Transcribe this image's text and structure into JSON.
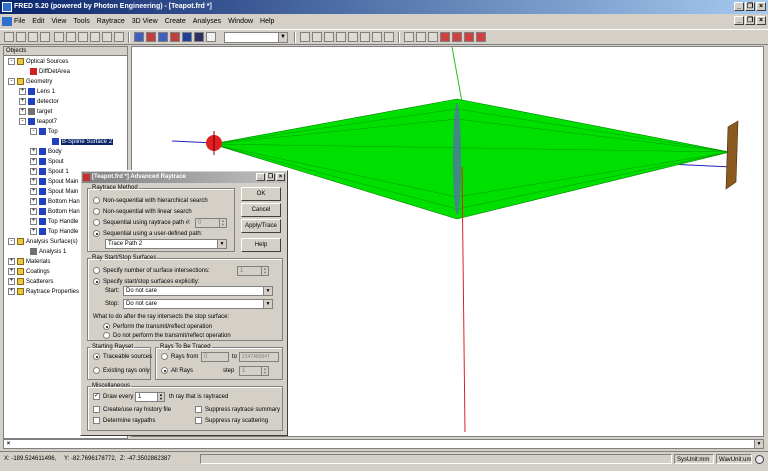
{
  "window": {
    "title": "FRED 5.20 (powered by Photon Engineering) - [Teapot.frd *]",
    "min": "_",
    "restore": "❐",
    "close": "×"
  },
  "menu": [
    "File",
    "Edit",
    "View",
    "Tools",
    "Raytrace",
    "3D View",
    "Create",
    "Analyses",
    "Window",
    "Help"
  ],
  "tree": {
    "header": "Objects",
    "nodes": [
      {
        "label": "Optical Sources",
        "exp": "-",
        "icon": "folder"
      },
      {
        "label": "DiffDetArea",
        "exp": "",
        "icon": "red"
      },
      {
        "label": "Geometry",
        "exp": "-",
        "icon": "folder"
      },
      {
        "label": "Lens 1",
        "exp": "+",
        "icon": "blue"
      },
      {
        "label": "detector",
        "exp": "+",
        "icon": "blue"
      },
      {
        "label": "target",
        "exp": "+",
        "icon": "grey"
      },
      {
        "label": "teapot7",
        "exp": "-",
        "icon": "blue"
      },
      {
        "label": "Top",
        "exp": "-",
        "icon": "blue"
      },
      {
        "label": "B-Spline Surface 2",
        "exp": "",
        "icon": "blue"
      },
      {
        "label": "Body",
        "exp": "+",
        "icon": "blue"
      },
      {
        "label": "Spout",
        "exp": "+",
        "icon": "blue"
      },
      {
        "label": "Spout 1",
        "exp": "+",
        "icon": "blue"
      },
      {
        "label": "Spout Main",
        "exp": "+",
        "icon": "blue"
      },
      {
        "label": "Spout Main",
        "exp": "+",
        "icon": "blue"
      },
      {
        "label": "Bottom Han",
        "exp": "+",
        "icon": "blue"
      },
      {
        "label": "Bottom Han",
        "exp": "+",
        "icon": "blue"
      },
      {
        "label": "Top Handle",
        "exp": "+",
        "icon": "blue"
      },
      {
        "label": "Top Handle",
        "exp": "+",
        "icon": "blue"
      },
      {
        "label": "Analysis Surface(s)",
        "exp": "-",
        "icon": "folder"
      },
      {
        "label": "Analysis 1",
        "exp": "",
        "icon": "grey"
      },
      {
        "label": "Materials",
        "exp": "+",
        "icon": "folder"
      },
      {
        "label": "Coatings",
        "exp": "+",
        "icon": "folder"
      },
      {
        "label": "Scatterers",
        "exp": "+",
        "icon": "folder"
      },
      {
        "label": "Raytrace Properties",
        "exp": "+",
        "icon": "folder"
      }
    ]
  },
  "dialog": {
    "title": "[Teapot.frd *] Advanced Raytrace",
    "buttons": {
      "ok": "OK",
      "cancel": "Cancel",
      "apply": "Apply/Trace",
      "help": "Help"
    },
    "method": {
      "legend": "Raytrace Method",
      "opt1": "Non-sequential with hierarchical search",
      "opt2": "Non-sequential with linear search",
      "opt3": "Sequential using raytrace path #:",
      "opt3_value": "0",
      "opt4": "Sequential using a user-defined path:",
      "path_value": "Trace Path 2"
    },
    "startstop": {
      "legend": "Ray Start/Stop Surfaces",
      "opt1": "Specify number of surface intersections:",
      "opt1_value": "1",
      "opt2": "Specify start/stop surfaces explicitly:",
      "start_label": "Start:",
      "start_value": "Do not care",
      "stop_label": "Stop:",
      "stop_value": "Do not care",
      "question": "What to do after the ray intersects the stop surface:",
      "opt3": "Perform the transmit/reflect operation",
      "opt4": "Do not perform the transmit/reflect operation"
    },
    "rayset": {
      "legend": "Starting Rayset",
      "opt1": "Traceable sources",
      "opt2": "Existing rays only"
    },
    "traced": {
      "legend": "Rays To Be Traced",
      "opt1": "Rays from",
      "from_value": "0",
      "to_label": "to",
      "to_value": "2147483647",
      "opt2": "All Rays",
      "step_label": "step",
      "step_value": "1"
    },
    "misc": {
      "legend": "Miscellaneous",
      "draw_every": "Draw every",
      "draw_value": "1",
      "draw_suffix": "th ray that is raytraced",
      "history": "Create/use ray history file",
      "suppress_summary": "Suppress raytrace summary",
      "determine": "Determine raypaths",
      "suppress_scatter": "Suppress ray scattering",
      "check": "✓"
    }
  },
  "bottom": {
    "close_glyph": "×",
    "dropdown_glyph": "▼"
  },
  "status": {
    "x": "X: -189.524611496,",
    "y": "Y: -82.7696178772,",
    "z": "Z: -47.3502862387",
    "sysunit": "SysUnit:mm",
    "wavunit": "WavUnit:um"
  },
  "colors": {
    "ray_green": "#00e000",
    "axis_red": "#e02020",
    "axis_blue": "#2020c0",
    "axis_green": "#20c020",
    "target_brown": "#8a5a20"
  }
}
